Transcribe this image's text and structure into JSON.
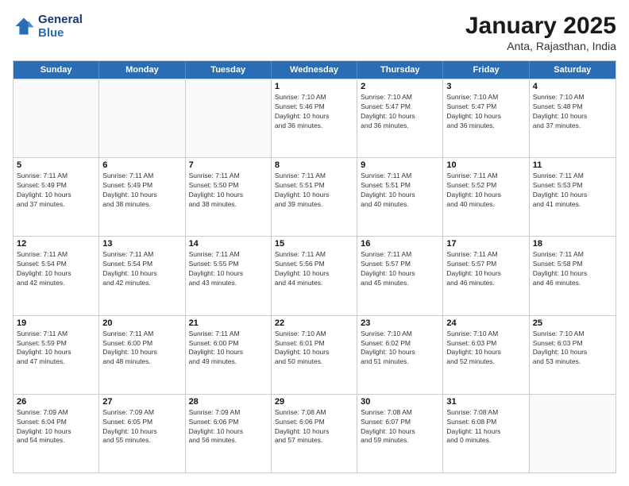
{
  "header": {
    "logo_line1": "General",
    "logo_line2": "Blue",
    "month": "January 2025",
    "location": "Anta, Rajasthan, India"
  },
  "weekdays": [
    "Sunday",
    "Monday",
    "Tuesday",
    "Wednesday",
    "Thursday",
    "Friday",
    "Saturday"
  ],
  "rows": [
    [
      {
        "day": "",
        "info": ""
      },
      {
        "day": "",
        "info": ""
      },
      {
        "day": "",
        "info": ""
      },
      {
        "day": "1",
        "info": "Sunrise: 7:10 AM\nSunset: 5:46 PM\nDaylight: 10 hours\nand 36 minutes."
      },
      {
        "day": "2",
        "info": "Sunrise: 7:10 AM\nSunset: 5:47 PM\nDaylight: 10 hours\nand 36 minutes."
      },
      {
        "day": "3",
        "info": "Sunrise: 7:10 AM\nSunset: 5:47 PM\nDaylight: 10 hours\nand 36 minutes."
      },
      {
        "day": "4",
        "info": "Sunrise: 7:10 AM\nSunset: 5:48 PM\nDaylight: 10 hours\nand 37 minutes."
      }
    ],
    [
      {
        "day": "5",
        "info": "Sunrise: 7:11 AM\nSunset: 5:49 PM\nDaylight: 10 hours\nand 37 minutes."
      },
      {
        "day": "6",
        "info": "Sunrise: 7:11 AM\nSunset: 5:49 PM\nDaylight: 10 hours\nand 38 minutes."
      },
      {
        "day": "7",
        "info": "Sunrise: 7:11 AM\nSunset: 5:50 PM\nDaylight: 10 hours\nand 38 minutes."
      },
      {
        "day": "8",
        "info": "Sunrise: 7:11 AM\nSunset: 5:51 PM\nDaylight: 10 hours\nand 39 minutes."
      },
      {
        "day": "9",
        "info": "Sunrise: 7:11 AM\nSunset: 5:51 PM\nDaylight: 10 hours\nand 40 minutes."
      },
      {
        "day": "10",
        "info": "Sunrise: 7:11 AM\nSunset: 5:52 PM\nDaylight: 10 hours\nand 40 minutes."
      },
      {
        "day": "11",
        "info": "Sunrise: 7:11 AM\nSunset: 5:53 PM\nDaylight: 10 hours\nand 41 minutes."
      }
    ],
    [
      {
        "day": "12",
        "info": "Sunrise: 7:11 AM\nSunset: 5:54 PM\nDaylight: 10 hours\nand 42 minutes."
      },
      {
        "day": "13",
        "info": "Sunrise: 7:11 AM\nSunset: 5:54 PM\nDaylight: 10 hours\nand 42 minutes."
      },
      {
        "day": "14",
        "info": "Sunrise: 7:11 AM\nSunset: 5:55 PM\nDaylight: 10 hours\nand 43 minutes."
      },
      {
        "day": "15",
        "info": "Sunrise: 7:11 AM\nSunset: 5:56 PM\nDaylight: 10 hours\nand 44 minutes."
      },
      {
        "day": "16",
        "info": "Sunrise: 7:11 AM\nSunset: 5:57 PM\nDaylight: 10 hours\nand 45 minutes."
      },
      {
        "day": "17",
        "info": "Sunrise: 7:11 AM\nSunset: 5:57 PM\nDaylight: 10 hours\nand 46 minutes."
      },
      {
        "day": "18",
        "info": "Sunrise: 7:11 AM\nSunset: 5:58 PM\nDaylight: 10 hours\nand 46 minutes."
      }
    ],
    [
      {
        "day": "19",
        "info": "Sunrise: 7:11 AM\nSunset: 5:59 PM\nDaylight: 10 hours\nand 47 minutes."
      },
      {
        "day": "20",
        "info": "Sunrise: 7:11 AM\nSunset: 6:00 PM\nDaylight: 10 hours\nand 48 minutes."
      },
      {
        "day": "21",
        "info": "Sunrise: 7:11 AM\nSunset: 6:00 PM\nDaylight: 10 hours\nand 49 minutes."
      },
      {
        "day": "22",
        "info": "Sunrise: 7:10 AM\nSunset: 6:01 PM\nDaylight: 10 hours\nand 50 minutes."
      },
      {
        "day": "23",
        "info": "Sunrise: 7:10 AM\nSunset: 6:02 PM\nDaylight: 10 hours\nand 51 minutes."
      },
      {
        "day": "24",
        "info": "Sunrise: 7:10 AM\nSunset: 6:03 PM\nDaylight: 10 hours\nand 52 minutes."
      },
      {
        "day": "25",
        "info": "Sunrise: 7:10 AM\nSunset: 6:03 PM\nDaylight: 10 hours\nand 53 minutes."
      }
    ],
    [
      {
        "day": "26",
        "info": "Sunrise: 7:09 AM\nSunset: 6:04 PM\nDaylight: 10 hours\nand 54 minutes."
      },
      {
        "day": "27",
        "info": "Sunrise: 7:09 AM\nSunset: 6:05 PM\nDaylight: 10 hours\nand 55 minutes."
      },
      {
        "day": "28",
        "info": "Sunrise: 7:09 AM\nSunset: 6:06 PM\nDaylight: 10 hours\nand 56 minutes."
      },
      {
        "day": "29",
        "info": "Sunrise: 7:08 AM\nSunset: 6:06 PM\nDaylight: 10 hours\nand 57 minutes."
      },
      {
        "day": "30",
        "info": "Sunrise: 7:08 AM\nSunset: 6:07 PM\nDaylight: 10 hours\nand 59 minutes."
      },
      {
        "day": "31",
        "info": "Sunrise: 7:08 AM\nSunset: 6:08 PM\nDaylight: 11 hours\nand 0 minutes."
      },
      {
        "day": "",
        "info": ""
      }
    ]
  ]
}
